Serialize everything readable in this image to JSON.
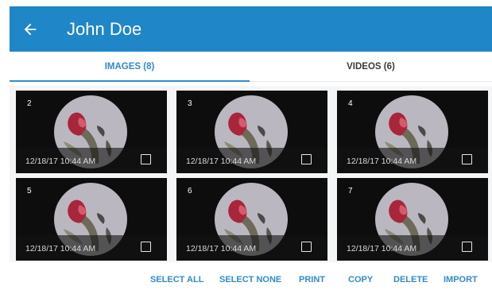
{
  "header": {
    "title": "John Doe",
    "back_icon": "arrow-left-icon",
    "color": "#1f87c8"
  },
  "tabs": [
    {
      "label": "IMAGES (8)",
      "active": true
    },
    {
      "label": "VIDEOS (6)",
      "active": false
    }
  ],
  "accent": "#2f8ccf",
  "thumbnails": [
    {
      "number": "2",
      "timestamp": "12/18/17 10:44 AM",
      "checked": false
    },
    {
      "number": "3",
      "timestamp": "12/18/17 10:44 AM",
      "checked": false
    },
    {
      "number": "4",
      "timestamp": "12/18/17 10:44 AM",
      "checked": false
    },
    {
      "number": "5",
      "timestamp": "12/18/17 10:44 AM",
      "checked": false
    },
    {
      "number": "6",
      "timestamp": "12/18/17 10:44 AM",
      "checked": false
    },
    {
      "number": "7",
      "timestamp": "12/18/17 10:44 AM",
      "checked": false
    }
  ],
  "actions": {
    "select_all": "SELECT ALL",
    "select_none": "SELECT NONE",
    "print": "PRINT",
    "copy": "COPY",
    "delete": "DELETE",
    "import": "IMPORT"
  }
}
